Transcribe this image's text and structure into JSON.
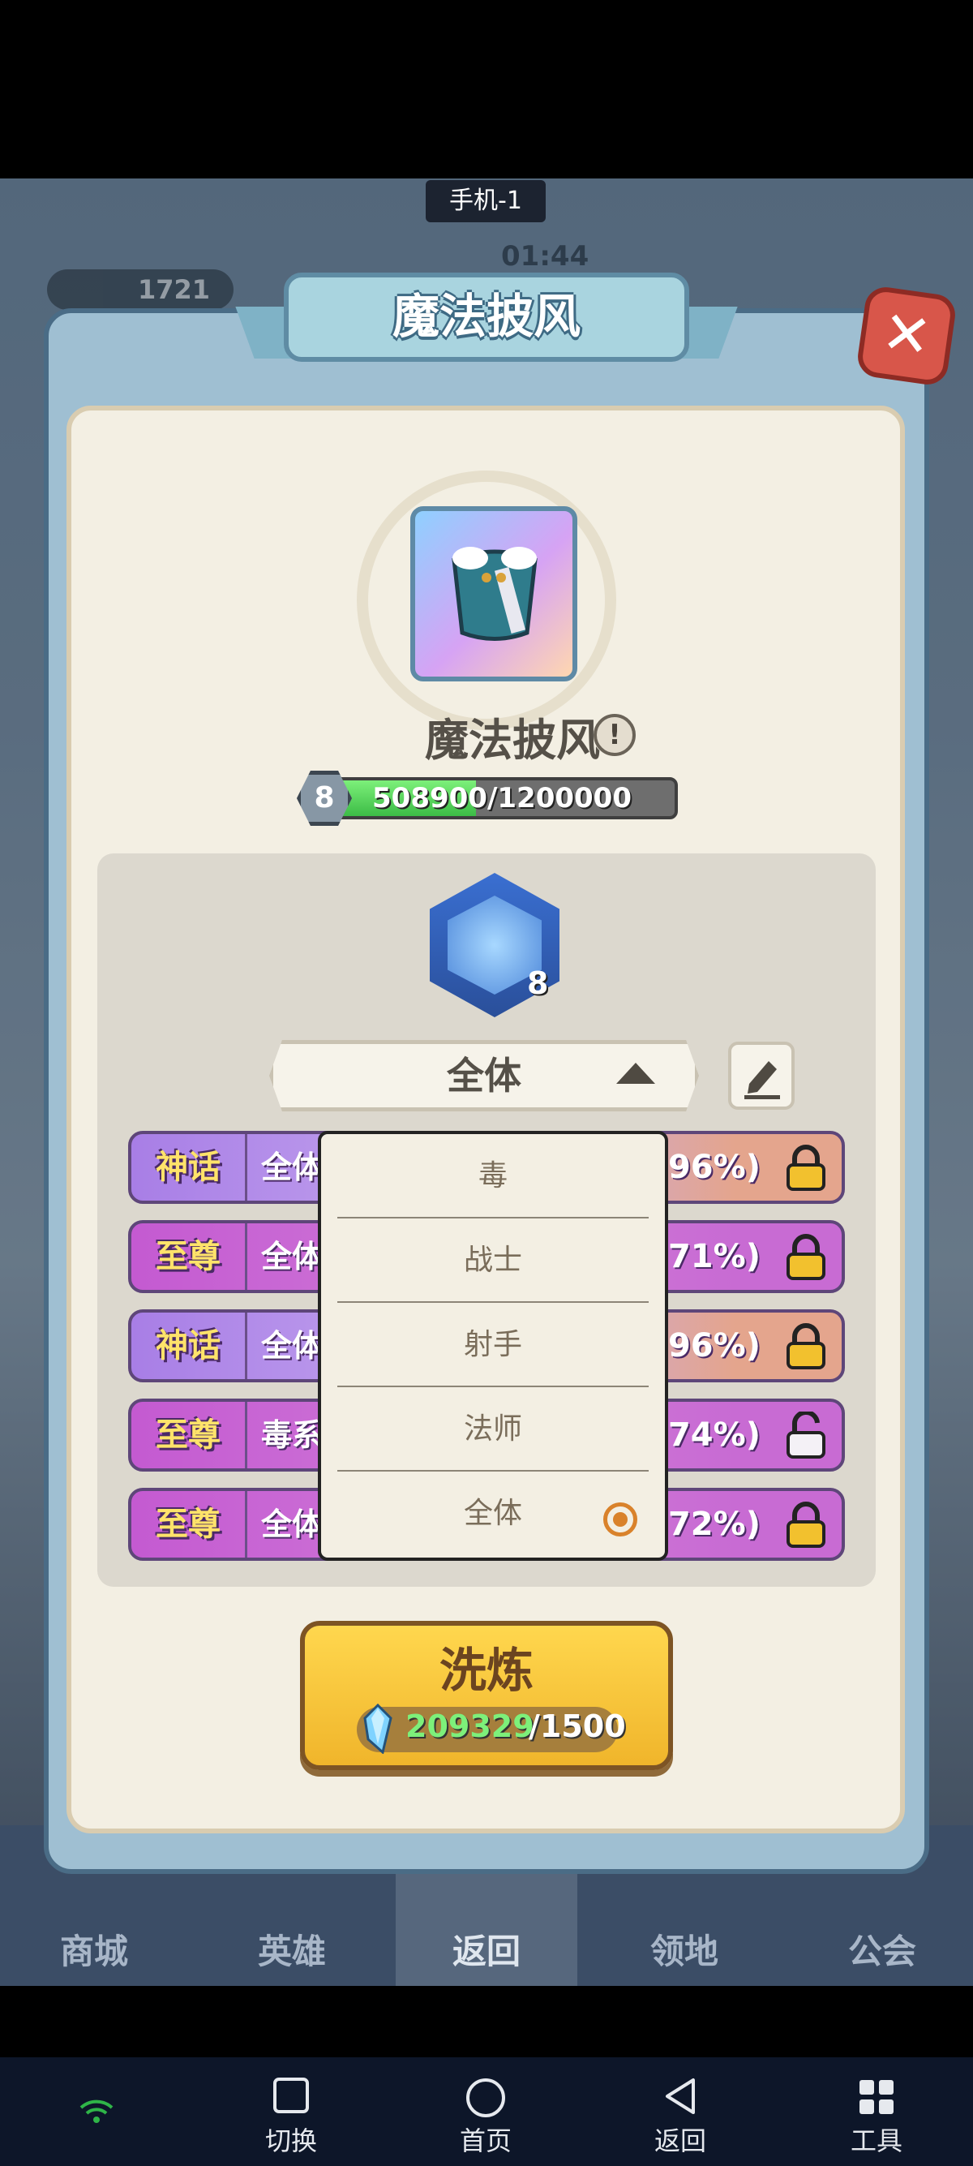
{
  "device": {
    "label": "手机-1"
  },
  "hud": {
    "gems": "1721",
    "timer": "01:44"
  },
  "dialog": {
    "title": "魔法披风",
    "item_name": "魔法披风",
    "info_icon": "!",
    "level": "8",
    "xp_text": "508900/1200000",
    "xp_fraction": 0.424,
    "hero_level": "8",
    "filter_label": "全体",
    "rows": [
      {
        "tag": "神话",
        "desc": "全体",
        "pct": "(96%)",
        "locked": true,
        "style": "myth"
      },
      {
        "tag": "至尊",
        "desc": "全体",
        "pct": "(71%)",
        "locked": true,
        "style": "sup"
      },
      {
        "tag": "神话",
        "desc": "全体",
        "pct": "(96%)",
        "locked": true,
        "style": "myth"
      },
      {
        "tag": "至尊",
        "desc": "毒系",
        "pct": "(74%)",
        "locked": false,
        "style": "sup"
      },
      {
        "tag": "至尊",
        "desc": "全体",
        "pct": "(72%)",
        "locked": true,
        "style": "sup"
      }
    ],
    "dropdown": {
      "options": [
        "毒",
        "战士",
        "射手",
        "法师",
        "全体"
      ],
      "selected": "全体"
    },
    "refine": {
      "label": "洗炼",
      "have": "209329",
      "need": "/1500"
    }
  },
  "game_nav": {
    "items": [
      "商城",
      "英雄",
      "返回",
      "领地",
      "公会"
    ],
    "active": "返回"
  },
  "system_nav": {
    "items": [
      "切换",
      "首页",
      "返回",
      "工具"
    ]
  },
  "colors": {
    "accent_orange": "#d9822b",
    "xp_green": "#3cbc46"
  }
}
